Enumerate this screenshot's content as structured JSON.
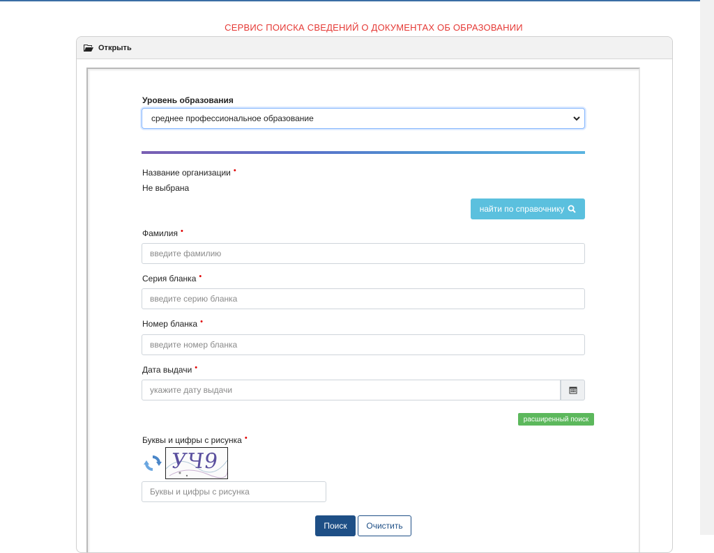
{
  "service_title": "СЕРВИС ПОИСКА СВЕДЕНИЙ О ДОКУМЕНТАХ ОБ ОБРАЗОВАНИИ",
  "panel": {
    "header_label": "Открыть",
    "header_icon": "folder-open-icon"
  },
  "form": {
    "education_level": {
      "label": "Уровень образования",
      "selected": "среднее профессиональное образование"
    },
    "organization": {
      "label": "Название организации",
      "value": "Не выбрана",
      "lookup_button": "найти по справочнику"
    },
    "surname": {
      "label": "Фамилия",
      "placeholder": "введите фамилию"
    },
    "series": {
      "label": "Серия бланка",
      "placeholder": "введите серию бланка"
    },
    "number": {
      "label": "Номер бланка",
      "placeholder": "введите номер бланка"
    },
    "issue_date": {
      "label": "Дата выдачи",
      "placeholder": "укажите дату выдачи"
    },
    "advanced_search": "расширенный поиск",
    "captcha": {
      "label": "Буквы и цифры с рисунка",
      "image_text": "УЧ9",
      "placeholder": "Буквы и цифры с рисунка"
    },
    "required_mark": "•",
    "search_button": "Поиск",
    "clear_button": "Очистить"
  },
  "colors": {
    "title_red": "#e53935",
    "info_blue": "#5bc0de",
    "success_green": "#5cb85c",
    "primary_navy": "#1e4f86"
  }
}
